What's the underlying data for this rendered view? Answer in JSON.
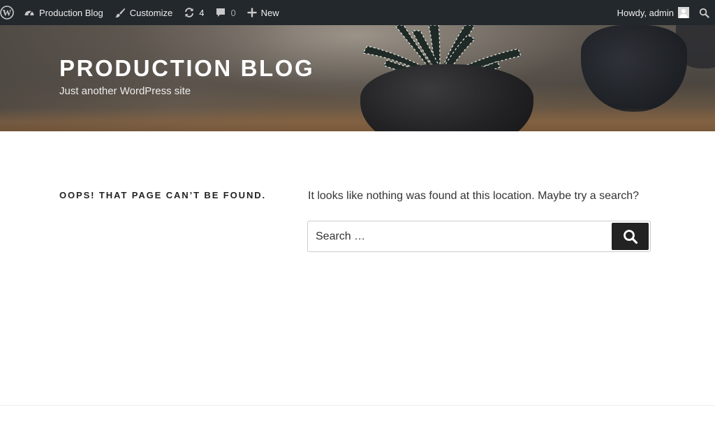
{
  "adminbar": {
    "site_name": "Production Blog",
    "customize_label": "Customize",
    "updates_count": "4",
    "comments_count": "0",
    "new_label": "New",
    "greeting": "Howdy, admin",
    "bg_color": "#23282d"
  },
  "header": {
    "site_title": "PRODUCTION BLOG",
    "site_description": "Just another WordPress site"
  },
  "main": {
    "page_title": "OOPS! THAT PAGE CAN’T BE FOUND.",
    "message": "It looks like nothing was found at this location. Maybe try a search?",
    "search": {
      "placeholder": "Search …",
      "value": ""
    }
  },
  "icons": {
    "wordpress": "wordpress-logo-icon",
    "dashboard": "dashboard-gauge-icon",
    "customize": "paintbrush-icon",
    "updates": "refresh-icon",
    "comments": "comment-bubble-icon",
    "new": "plus-icon",
    "search": "search-icon"
  }
}
